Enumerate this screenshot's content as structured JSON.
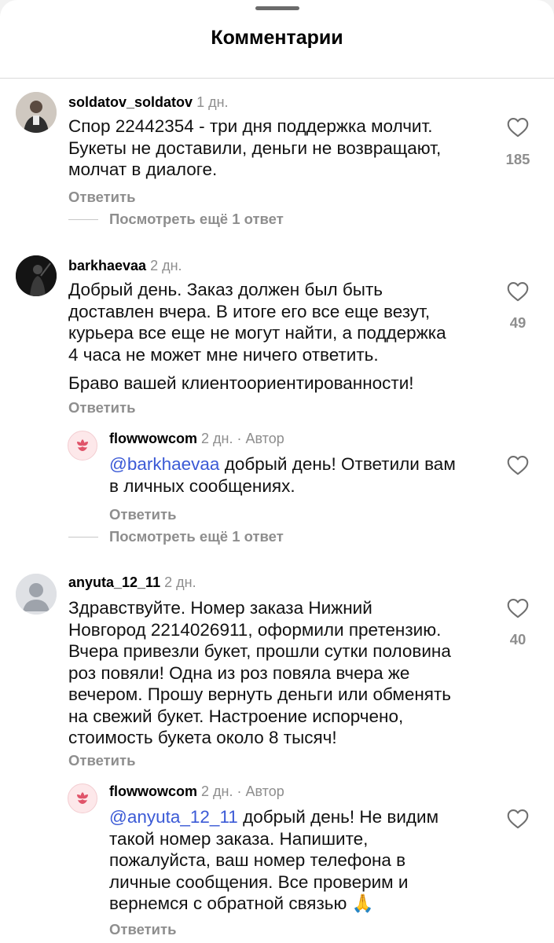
{
  "header": {
    "title": "Комментарии"
  },
  "comments": [
    {
      "username": "soldatov_soldatov",
      "time": "1 дн.",
      "text": [
        "Спор 22442354 - три дня поддержка молчит.",
        "Букеты не доставили, деньги не возвращают,",
        "молчат в диалоге."
      ],
      "likes": "185",
      "reply_label": "Ответить",
      "view_more": "Посмотреть ещё 1 ответ"
    },
    {
      "username": "barkhaevaa",
      "time": "2 дн.",
      "text": [
        "Добрый день. Заказ должен был быть",
        "доставлен вчера. В итоге его все еще везут,",
        "курьера все еще не могут найти, а поддержка",
        "4 часа не может мне ничего ответить."
      ],
      "text2": "Браво вашей клиентоориентированности!",
      "likes": "49",
      "reply_label": "Ответить",
      "reply": {
        "username": "flowwowcom",
        "time": "2 дн.",
        "author": "· Автор",
        "mention": "@barkhaevaa",
        "text_first": " добрый день! Ответили вам",
        "text_rest": "в личных сообщениях.",
        "reply_label": "Ответить",
        "view_more": "Посмотреть ещё 1 ответ"
      }
    },
    {
      "username": "anyuta_12_11",
      "time": "2 дн.",
      "text": [
        "Здравствуйте. Номер заказа Нижний",
        "Новгород 2214026911, оформили претензию.",
        "Вчера привезли букет, прошли сутки половина",
        "роз повяли! Одна из роз повяла вчера же",
        "вечером. Прошу вернуть деньги или обменять",
        "на свежий букет. Настроение испорчено,",
        "стоимость букета около 8 тысяч!"
      ],
      "likes": "40",
      "reply_label": "Ответить",
      "reply": {
        "username": "flowwowcom",
        "time": "2 дн.",
        "author": "· Автор",
        "mention": "@anyuta_12_11",
        "text_first": " добрый день! Не видим",
        "text_rest": [
          "такой номер заказа. Напишите,",
          "пожалуйста, ваш номер телефона в",
          "личные сообщения. Все проверим и",
          "вернемся с обратной связью 🙏"
        ],
        "reply_label": "Ответить"
      }
    }
  ]
}
